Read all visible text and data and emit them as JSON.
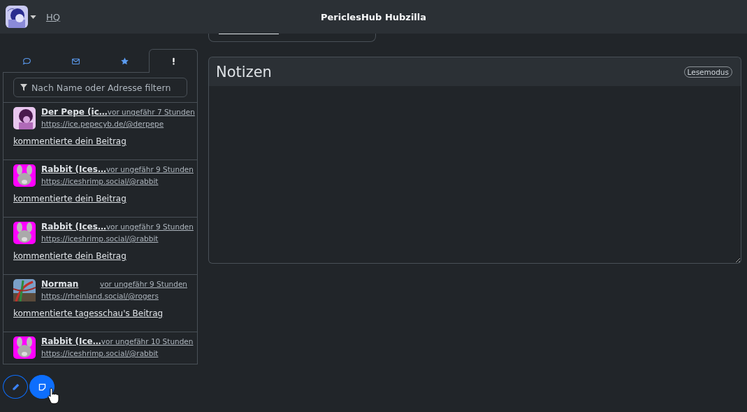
{
  "navbar": {
    "home_link": "HQ",
    "site_title": "PericlesHub Hubzilla"
  },
  "tabs": [
    {
      "selected": false
    },
    {
      "selected": false
    },
    {
      "selected": false
    },
    {
      "selected": true
    }
  ],
  "filter": {
    "placeholder": "Nach Name oder Adresse filtern"
  },
  "notifications": [
    {
      "name": "Der Pepe (ic…",
      "time": "vor ungefähr 7 Stunden",
      "address": "https://ice.pepecyb.de/@derpepe",
      "message": "kommentierte dein Beitrag"
    },
    {
      "name": "Rabbit (Ices…",
      "time": "vor ungefähr 9 Stunden",
      "address": "https://iceshrimp.social/@rabbit",
      "message": "kommentierte dein Beitrag"
    },
    {
      "name": "Rabbit (Ices…",
      "time": "vor ungefähr 9 Stunden",
      "address": "https://iceshrimp.social/@rabbit",
      "message": "kommentierte dein Beitrag"
    },
    {
      "name": "Norman",
      "time": "vor ungefähr 9 Stunden",
      "address": "https://rheinland.social/@rogers",
      "message": "kommentierte tagesschau's Beitrag"
    },
    {
      "name": "Rabbit (Ice…",
      "time": "vor ungefähr 10 Stunden",
      "address": "https://iceshrimp.social/@rabbit"
    }
  ],
  "notes": {
    "title": "Notizen",
    "mode_badge": "Lesemodus"
  }
}
